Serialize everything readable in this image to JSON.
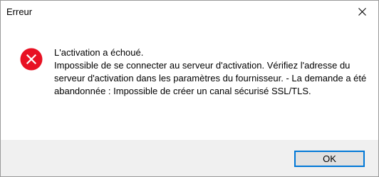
{
  "window": {
    "title": "Erreur"
  },
  "titlebar": {
    "close_icon": "close-icon"
  },
  "icon": {
    "name": "error-icon",
    "color": "#e81123"
  },
  "message": {
    "heading": "L'activation a échoué.",
    "body": "Impossible de se connecter au serveur d'activation. Vérifiez l'adresse du serveur d'activation dans les paramètres du fournisseur. - La demande a été abandonnée : Impossible de créer un canal sécurisé SSL/TLS."
  },
  "buttons": {
    "ok_label": "OK"
  },
  "colors": {
    "footer_bg": "#f0f0f0",
    "button_border": "#0078d7",
    "button_bg": "#e1e1e1"
  }
}
